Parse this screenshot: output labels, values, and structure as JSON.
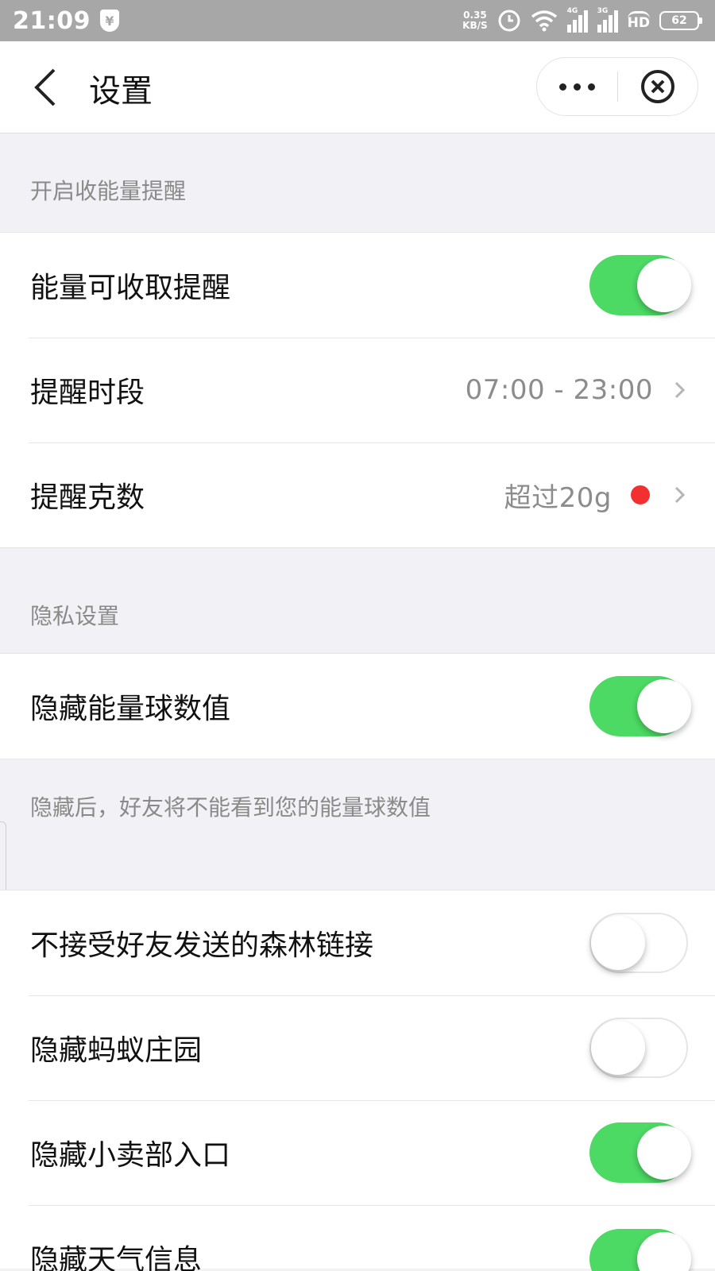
{
  "status_bar": {
    "time": "21:09",
    "shield_glyph": "¥",
    "speed_value": "0.35",
    "speed_unit": "KB/S",
    "net1_label": "4G",
    "net2_label": "3G",
    "hd_label": "HD",
    "battery": "62"
  },
  "nav": {
    "title": "设置"
  },
  "sections": {
    "energy_header": "开启收能量提醒",
    "privacy_header": "隐私设置"
  },
  "energy": {
    "collect_reminder_label": "能量可收取提醒",
    "collect_reminder_on": true,
    "period_label": "提醒时段",
    "period_value": "07:00 - 23:00",
    "grams_label": "提醒克数",
    "grams_value": "超过20g"
  },
  "privacy": {
    "hide_ball_label": "隐藏能量球数值",
    "hide_ball_on": true,
    "hide_ball_note": "隐藏后，好友将不能看到您的能量球数值"
  },
  "others": {
    "reject_links_label": "不接受好友发送的森林链接",
    "reject_links_on": false,
    "hide_farm_label": "隐藏蚂蚁庄园",
    "hide_farm_on": false,
    "hide_shop_label": "隐藏小卖部入口",
    "hide_shop_on": true,
    "hide_weather_label": "隐藏天气信息",
    "hide_weather_on": true
  },
  "colors": {
    "toggle_on": "#4cd964",
    "badge_red": "#f23030",
    "status_bar_bg": "#a7a7a7"
  },
  "icons": [
    "back-arrow-icon",
    "more-dots-icon",
    "close-circle-icon",
    "chevron-right-icon",
    "wifi-icon",
    "alarm-icon",
    "battery-icon"
  ]
}
